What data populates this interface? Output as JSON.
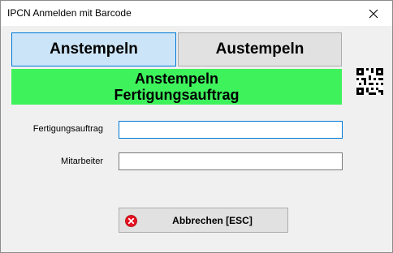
{
  "window": {
    "title": "IPCN Anmelden mit Barcode",
    "close_icon": "close-icon"
  },
  "mode_buttons": {
    "in_label": "Anstempeln",
    "out_label": "Austempeln",
    "selected": "in"
  },
  "banner": {
    "line1": "Anstempeln",
    "line2": "Fertigungsauftrag",
    "color": "#3ef25c"
  },
  "qr_icon": "qr-code-icon",
  "form": {
    "order_label": "Fertigungsauftrag",
    "order_value": "",
    "employee_label": "Mitarbeiter",
    "employee_value": ""
  },
  "cancel_button": {
    "label": "Abbrechen [ESC]",
    "icon": "cancel-icon",
    "icon_color": "#e81123"
  },
  "colors": {
    "accent": "#0078d7",
    "selected_button": "#cce4f7"
  }
}
